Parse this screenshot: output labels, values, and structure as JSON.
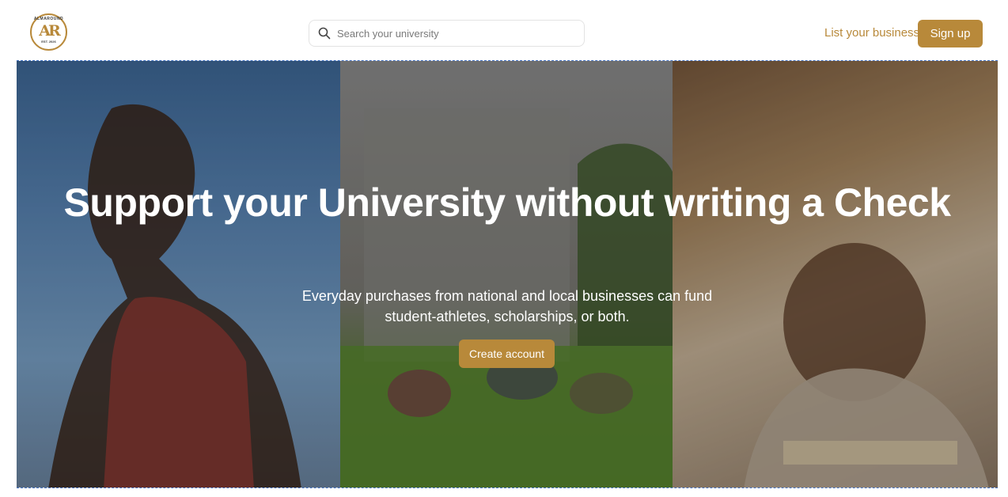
{
  "header": {
    "logo": {
      "top_text": "ALMAROUND",
      "mark": "AR",
      "bottom_text": "EST. 2026"
    },
    "search": {
      "placeholder": "Search your university",
      "icon": "search-icon"
    },
    "list_business_label": "List your business",
    "signup_label": "Sign up"
  },
  "hero": {
    "title": "Support your University without writing a Check",
    "subtitle": "Everyday purchases from national and local businesses can fund student-athletes, scholarships, or both.",
    "cta_label": "Create account"
  },
  "colors": {
    "accent": "#b8893a",
    "text_on_image": "#ffffff"
  }
}
